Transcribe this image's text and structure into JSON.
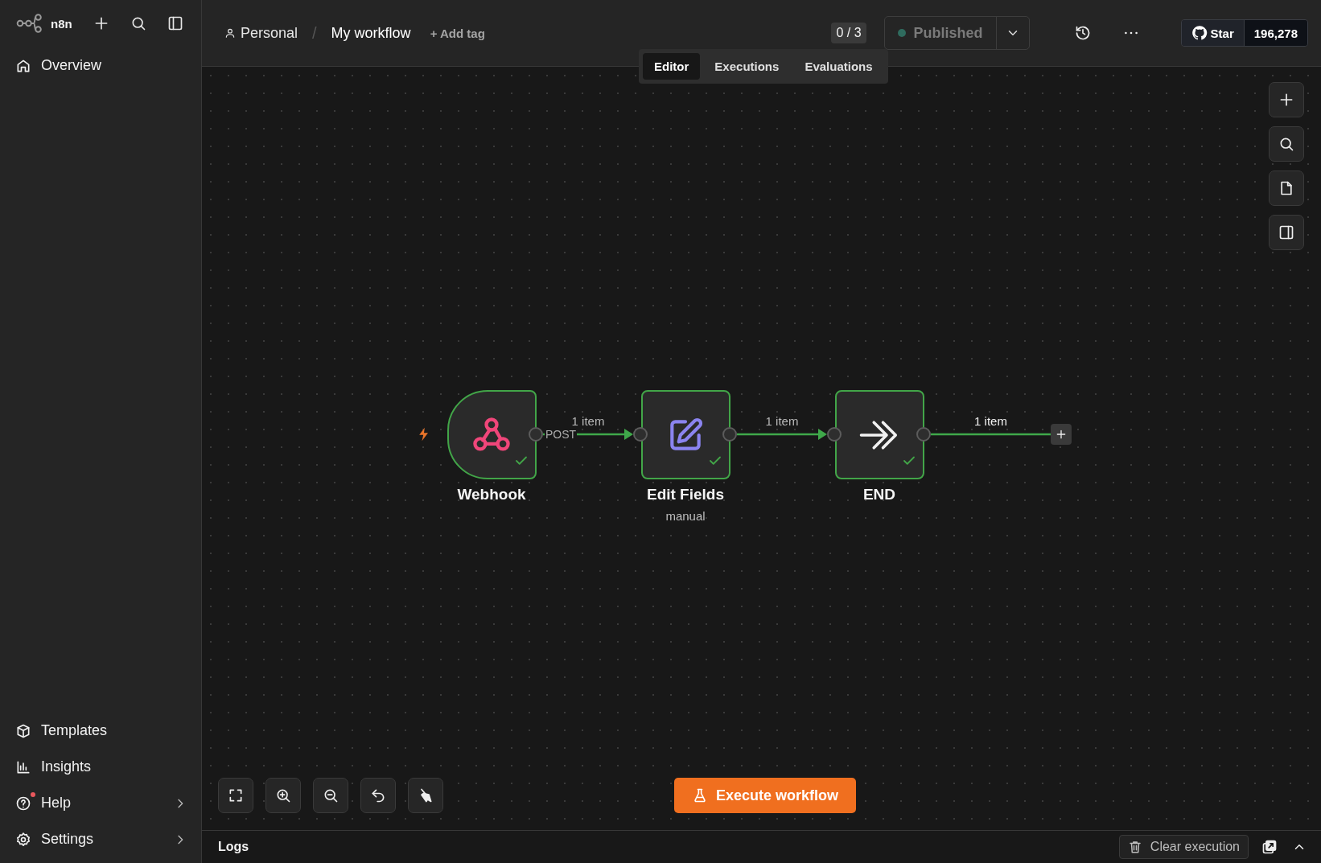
{
  "sidebar": {
    "brand": "n8n",
    "items": [
      {
        "label": "Overview",
        "kind": "home"
      }
    ],
    "bottom_items": [
      {
        "label": "Templates",
        "kind": "templates",
        "submenu": false,
        "notification": false
      },
      {
        "label": "Insights",
        "kind": "insights",
        "submenu": false,
        "notification": false
      },
      {
        "label": "Help",
        "kind": "help",
        "submenu": true,
        "notification": true
      },
      {
        "label": "Settings",
        "kind": "settings",
        "submenu": true,
        "notification": false
      }
    ]
  },
  "breadcrumb": {
    "project": "Personal",
    "separator": "/",
    "workflow": "My workflow",
    "add_tag": "+ Add tag"
  },
  "header": {
    "counter": "0 / 3",
    "publish": "Published",
    "github_label": "Star",
    "github_count": "196,278"
  },
  "view_tabs": [
    {
      "label": "Editor",
      "selected": true
    },
    {
      "label": "Executions",
      "selected": false
    },
    {
      "label": "Evaluations",
      "selected": false
    }
  ],
  "nodes": [
    {
      "name": "Webhook",
      "kind": "webhook",
      "success": true
    },
    {
      "name": "Edit Fields",
      "kind": "set",
      "subtitle": "manual",
      "success": true
    },
    {
      "name": "END",
      "kind": "noop",
      "success": true
    }
  ],
  "connections": [
    {
      "label": "1 item",
      "branch": "POST"
    },
    {
      "label": "1 item"
    },
    {
      "label": "1 item"
    }
  ],
  "execute_button": "Execute workflow",
  "logs": {
    "title": "Logs",
    "clear": "Clear execution"
  }
}
